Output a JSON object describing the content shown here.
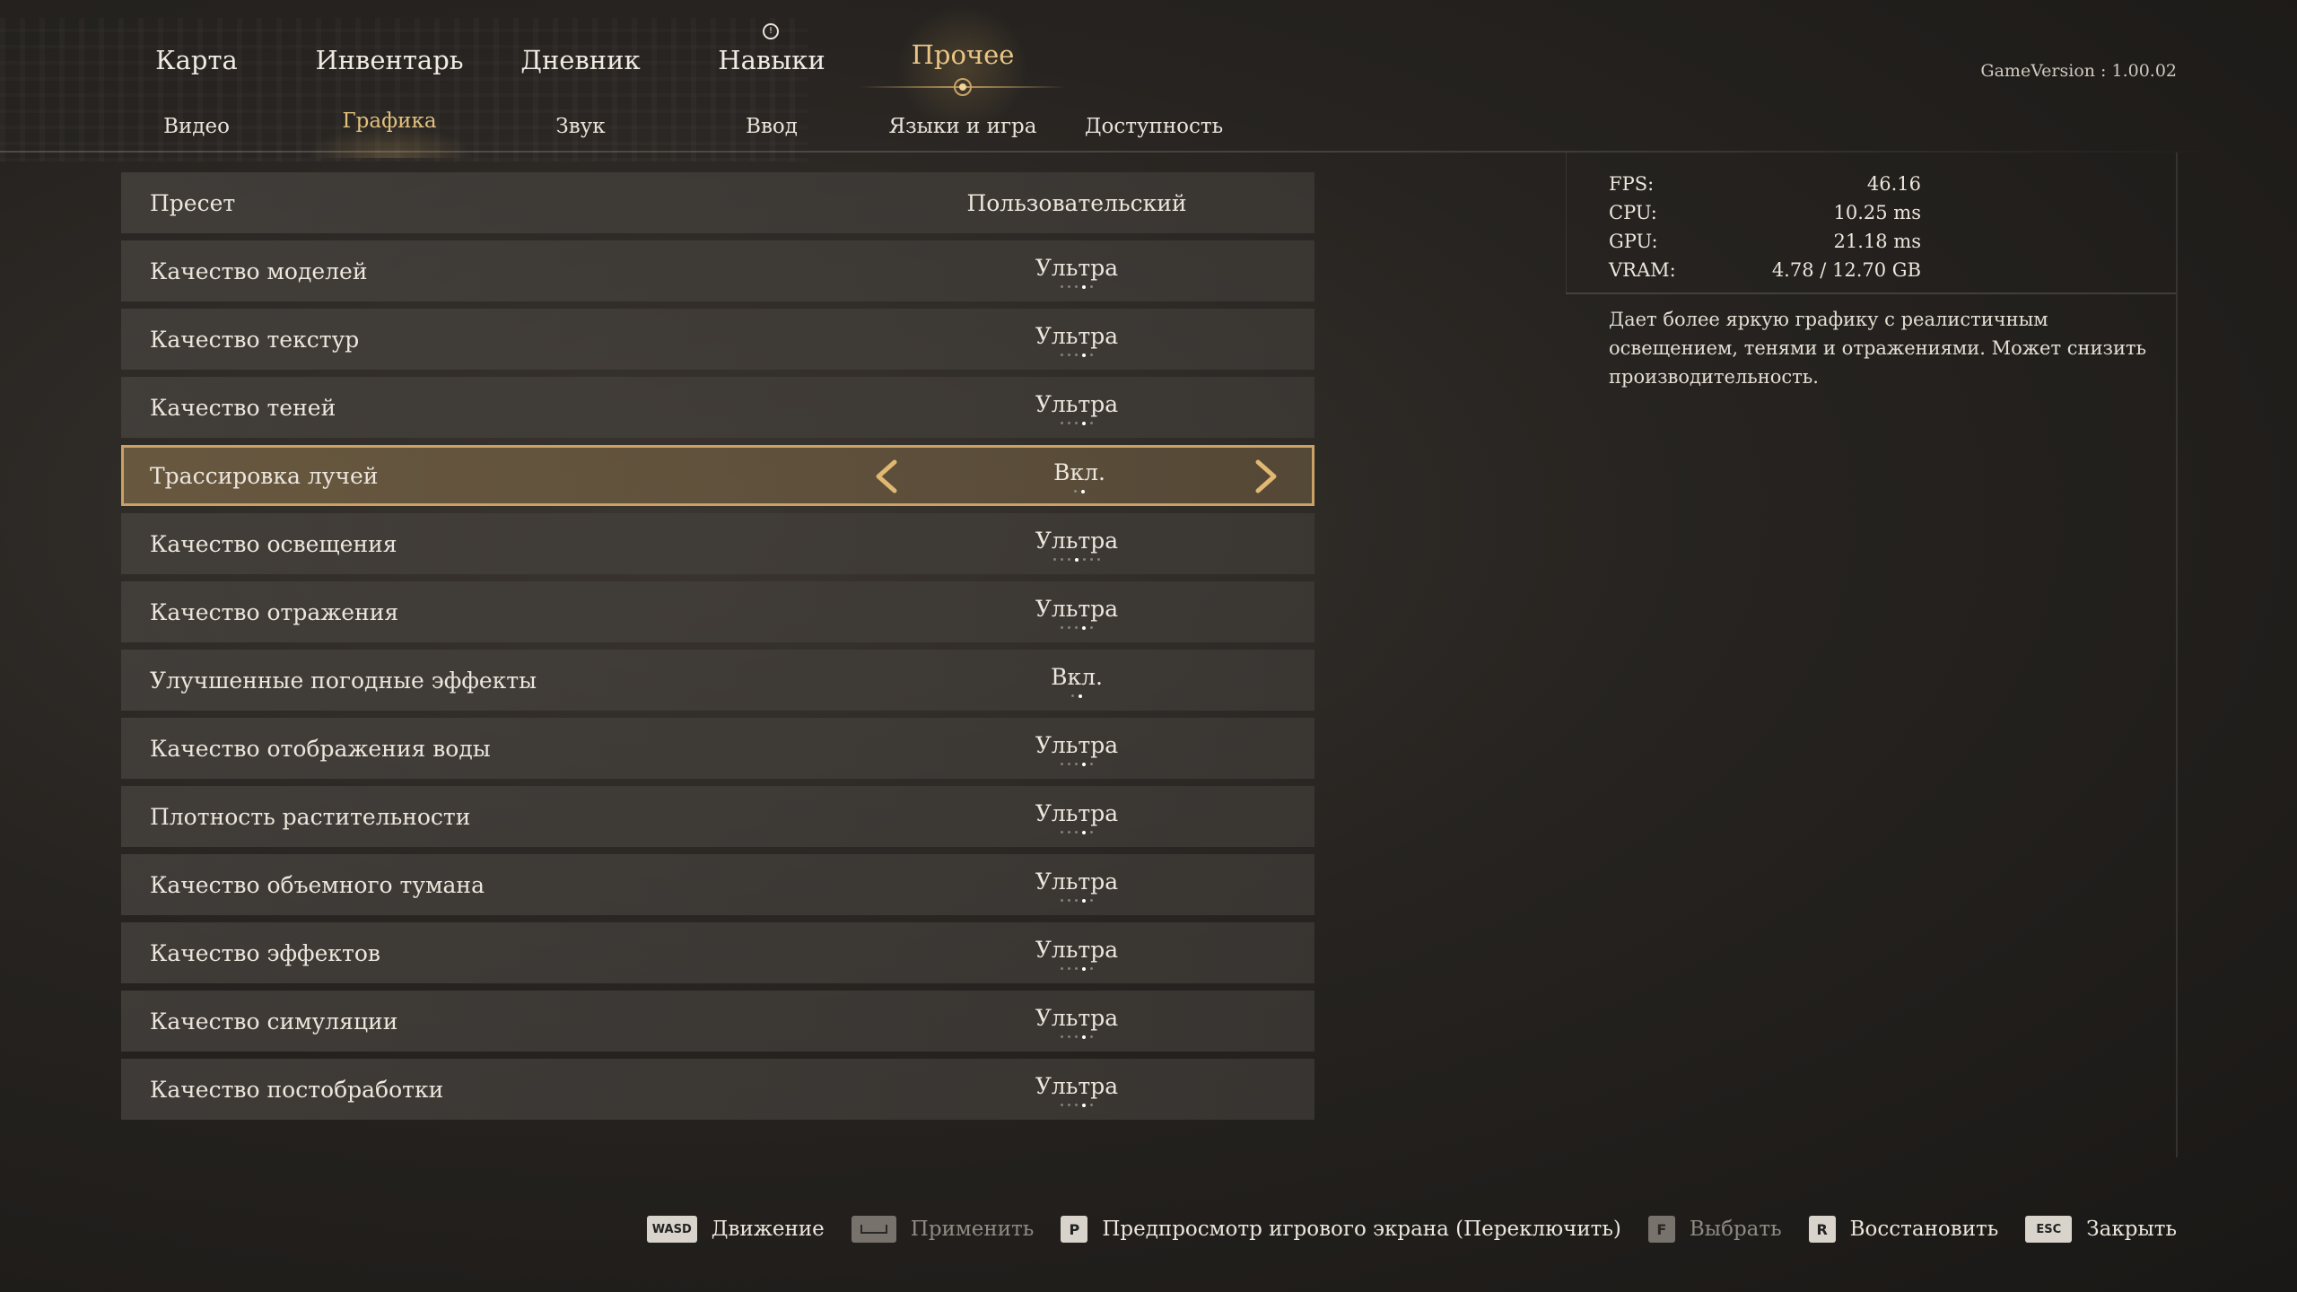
{
  "top_nav": {
    "tabs": [
      {
        "label": "Карта"
      },
      {
        "label": "Инвентарь"
      },
      {
        "label": "Дневник"
      },
      {
        "label": "Навыки"
      },
      {
        "label": "Прочее",
        "active": true
      }
    ]
  },
  "sub_nav": {
    "tabs": [
      {
        "label": "Видео"
      },
      {
        "label": "Графика",
        "active": true
      },
      {
        "label": "Звук"
      },
      {
        "label": "Ввод"
      },
      {
        "label": "Языки и игра"
      },
      {
        "label": "Доступность"
      }
    ]
  },
  "game_version": "GameVersion : 1.00.02",
  "settings": [
    {
      "label": "Пресет",
      "value": "Пользовательский"
    },
    {
      "label": "Качество моделей",
      "value": "Ультра",
      "level": 4,
      "levels": 5
    },
    {
      "label": "Качество текстур",
      "value": "Ультра",
      "level": 4,
      "levels": 5
    },
    {
      "label": "Качество теней",
      "value": "Ультра",
      "level": 4,
      "levels": 5
    },
    {
      "label": "Трассировка лучей",
      "value": "Вкл.",
      "level": 2,
      "levels": 2,
      "selected": true
    },
    {
      "label": "Качество освещения",
      "value": "Ультра",
      "level": 4,
      "levels": 7
    },
    {
      "label": "Качество отражения",
      "value": "Ультра",
      "level": 4,
      "levels": 5
    },
    {
      "label": "Улучшенные погодные эффекты",
      "value": "Вкл.",
      "level": 2,
      "levels": 2
    },
    {
      "label": "Качество отображения воды",
      "value": "Ультра",
      "level": 4,
      "levels": 5
    },
    {
      "label": "Плотность растительности",
      "value": "Ультра",
      "level": 4,
      "levels": 5
    },
    {
      "label": "Качество объемного тумана",
      "value": "Ультра",
      "level": 4,
      "levels": 5
    },
    {
      "label": "Качество эффектов",
      "value": "Ультра",
      "level": 4,
      "levels": 5
    },
    {
      "label": "Качество симуляции",
      "value": "Ультра",
      "level": 4,
      "levels": 5
    },
    {
      "label": "Качество постобработки",
      "value": "Ультра",
      "level": 4,
      "levels": 5
    }
  ],
  "stats": [
    {
      "label": "FPS:",
      "value": "46.16"
    },
    {
      "label": "CPU:",
      "value": "10.25  ms"
    },
    {
      "label": "GPU:",
      "value": "21.18  ms"
    },
    {
      "label": "VRAM:",
      "value": "4.78  /  12.70  GB"
    }
  ],
  "description": "Дает более яркую графику с реалистичным освещением, тенями и отражениями. Может снизить производительность.",
  "hints": [
    {
      "key": "WASD",
      "label": "Движение",
      "dim": false
    },
    {
      "key": "",
      "label": "Применить",
      "dim": true,
      "icon": "spacebar-icon"
    },
    {
      "key": "P",
      "label": "Предпросмотр игрового экрана (Переключить)",
      "dim": false
    },
    {
      "key": "F",
      "label": "Выбрать",
      "dim": true
    },
    {
      "key": "R",
      "label": "Восстановить",
      "dim": false
    },
    {
      "key": "ESC",
      "label": "Закрыть",
      "dim": false
    }
  ],
  "colors": {
    "accent": "#e2c07e",
    "selected_border": "#c9a264",
    "row_bg": "#46423e"
  }
}
